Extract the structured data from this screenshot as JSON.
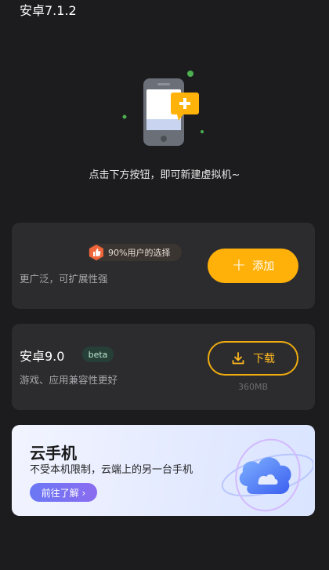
{
  "hero": {
    "hint": "点击下方按钮，即可新建虚拟机~"
  },
  "options": [
    {
      "title": "安卓7.1.2",
      "badge": "90%用户的选择",
      "subtitle": "更广泛，可扩展性强",
      "action_label": "添加",
      "action_icon": "plus-icon"
    },
    {
      "title": "安卓9.0",
      "tag": "beta",
      "subtitle": "游戏、应用兼容性更好",
      "action_label": "下载",
      "action_icon": "download-icon",
      "size": "360MB"
    }
  ],
  "cloud_phone": {
    "title": "云手机",
    "subtitle": "不受本机限制，云端上的另一台手机",
    "cta": "前往了解 ›"
  },
  "colors": {
    "background": "#1c1c1e",
    "card": "#2c2c2e",
    "accent": "#ffb10a",
    "badge_bg": "#3b3531",
    "beta_bg": "#264038",
    "cloud_cta": "#7a72f2"
  }
}
